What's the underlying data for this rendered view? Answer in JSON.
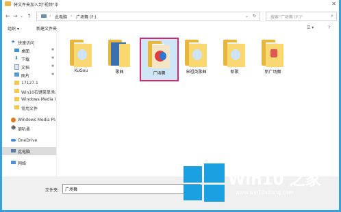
{
  "window": {
    "title": "将文件夹加入到\"视频\"中"
  },
  "address": {
    "crumbs": [
      "此电脑",
      "广场舞 (F:)"
    ],
    "search_placeholder": "搜索\"广场舞 (F:)\""
  },
  "toolbar": {
    "organize": "组织 ▾",
    "new_folder": "新建文件夹"
  },
  "sidebar": {
    "items": [
      {
        "label": "快速访问",
        "icon": "star-icon"
      },
      {
        "label": "桌面",
        "icon": "desktop-icon",
        "pinned": true
      },
      {
        "label": "下载",
        "icon": "download-icon",
        "pinned": true
      },
      {
        "label": "文档",
        "icon": "document-icon",
        "pinned": true
      },
      {
        "label": "图片",
        "icon": "picture-icon",
        "pinned": true
      },
      {
        "label": "17127.1",
        "icon": "folder-icon"
      },
      {
        "label": "Win10右键菜单添加",
        "icon": "folder-icon"
      },
      {
        "label": "Windows Media Pla",
        "icon": "folder-icon"
      },
      {
        "label": "常用文件",
        "icon": "folder-icon"
      },
      {
        "label": "Windows Media Pla",
        "icon": "media-player-icon"
      },
      {
        "label": "周叭柔",
        "icon": "user-icon"
      },
      {
        "label": "OneDrive",
        "icon": "cloud-icon"
      },
      {
        "label": "此电脑",
        "icon": "computer-icon",
        "selected": true
      },
      {
        "label": "网络",
        "icon": "network-icon"
      }
    ]
  },
  "files": [
    {
      "label": "KuGou"
    },
    {
      "label": "歌曲"
    },
    {
      "label": "广场舞",
      "selected": true
    },
    {
      "label": "宋祖英歌曲"
    },
    {
      "label": "新歌"
    },
    {
      "label": "新广场舞"
    }
  ],
  "footer": {
    "filename_label": "文件夹:",
    "filename_value": "广场舞"
  },
  "watermark": {
    "title": "Win10 之家",
    "url": "www.win10xitong.com"
  },
  "colors": {
    "accent": "#3aa0d6",
    "selection": "#d6286e",
    "folder": "#f9d872"
  }
}
